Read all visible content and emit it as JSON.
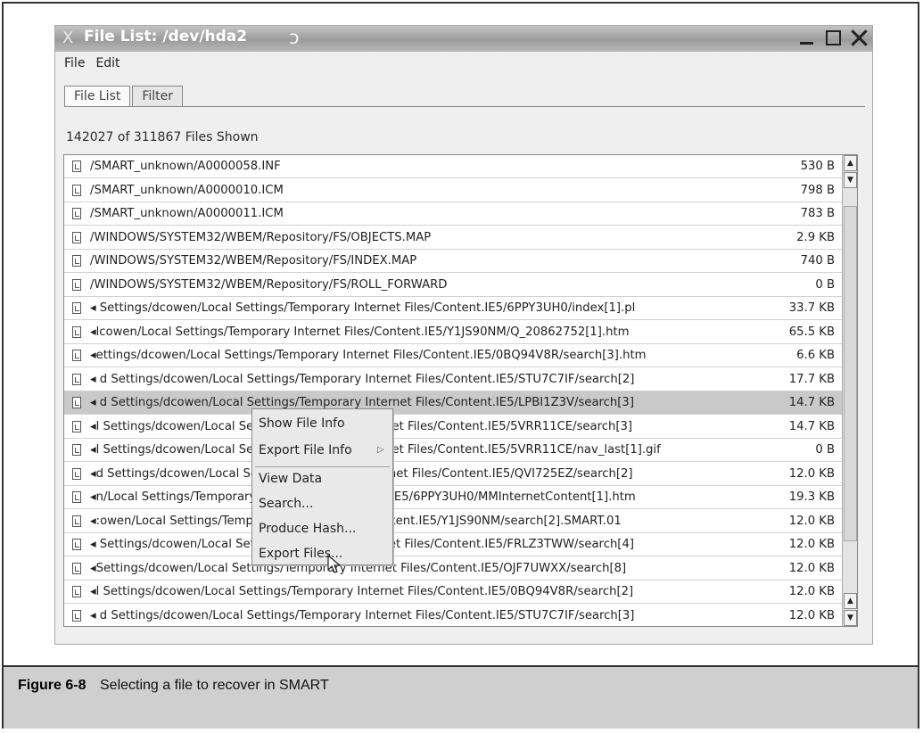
{
  "window": {
    "title": "File List: /dev/hda2",
    "close_glyph": "X",
    "swirl_glyph": "ↄ"
  },
  "menubar": [
    "File",
    "Edit"
  ],
  "tabs": [
    "File List",
    "Filter"
  ],
  "status": "142027 of 311867 Files Shown",
  "files": [
    {
      "name": "/SMART_unknown/A0000058.INF",
      "size": "530 B"
    },
    {
      "name": "/SMART_unknown/A0000010.ICM",
      "size": "798 B"
    },
    {
      "name": "/SMART_unknown/A0000011.ICM",
      "size": "783 B"
    },
    {
      "name": "/WINDOWS/SYSTEM32/WBEM/Repository/FS/OBJECTS.MAP",
      "size": "2.9 KB"
    },
    {
      "name": "/WINDOWS/SYSTEM32/WBEM/Repository/FS/INDEX.MAP",
      "size": "740 B"
    },
    {
      "name": "/WINDOWS/SYSTEM32/WBEM/Repository/FS/ROLL_FORWARD",
      "size": "0 B"
    },
    {
      "name": "◂ Settings/dcowen/Local Settings/Temporary Internet Files/Content.IE5/6PPY3UH0/index[1].pl",
      "size": "33.7 KB"
    },
    {
      "name": "◂lcowen/Local Settings/Temporary Internet Files/Content.IE5/Y1JS90NM/Q_20862752[1].htm",
      "size": "65.5 KB"
    },
    {
      "name": "◂ettings/dcowen/Local Settings/Temporary Internet Files/Content.IE5/0BQ94V8R/search[3].htm",
      "size": "6.6 KB"
    },
    {
      "name": "◂ d Settings/dcowen/Local Settings/Temporary Internet Files/Content.IE5/STU7C7IF/search[2]",
      "size": "17.7 KB"
    },
    {
      "name": "◂ d Settings/dcowen/Local Settings/Temporary Internet Files/Content.IE5/LPBI1Z3V/search[3]",
      "size": "14.7 KB"
    },
    {
      "name": "◂l Settings/dcowen/Local Settings/Temporary Internet Files/Content.IE5/5VRR11CE/search[3]",
      "size": "14.7 KB"
    },
    {
      "name": "◂l Settings/dcowen/Local Settings/Temporary Internet Files/Content.IE5/5VRR11CE/nav_last[1].gif",
      "size": "0 B"
    },
    {
      "name": "◂d Settings/dcowen/Local Settings/Temporary Internet Files/Content.IE5/QVI725EZ/search[2]",
      "size": "12.0 KB"
    },
    {
      "name": "◂n/Local Settings/Temporary Internet Files/Content.IE5/6PPY3UH0/MMInternetContent[1].htm",
      "size": "19.3 KB"
    },
    {
      "name": "◂:owen/Local Settings/Temporary Internet Files/Content.IE5/Y1JS90NM/search[2].SMART.01",
      "size": "12.0 KB"
    },
    {
      "name": "◂ Settings/dcowen/Local Settings/Temporary Internet Files/Content.IE5/FRLZ3TWW/search[4]",
      "size": "12.0 KB"
    },
    {
      "name": "◂Settings/dcowen/Local Settings/Temporary Internet Files/Content.IE5/OJF7UWXX/search[8]",
      "size": "12.0 KB"
    },
    {
      "name": "◂l Settings/dcowen/Local Settings/Temporary Internet Files/Content.IE5/0BQ94V8R/search[2]",
      "size": "12.0 KB"
    },
    {
      "name": "◂ d Settings/dcowen/Local Settings/Temporary Internet Files/Content.IE5/STU7C7IF/search[3]",
      "size": "12.0 KB"
    }
  ],
  "selected_index": 10,
  "context_menu": {
    "items": [
      "Show File Info",
      "Export File Info",
      "View Data",
      "Search...",
      "Produce Hash...",
      "Export Files..."
    ],
    "submenu_arrow": "▷"
  },
  "caption": {
    "label": "Figure 6-8",
    "text": "Selecting a file to recover in SMART"
  }
}
